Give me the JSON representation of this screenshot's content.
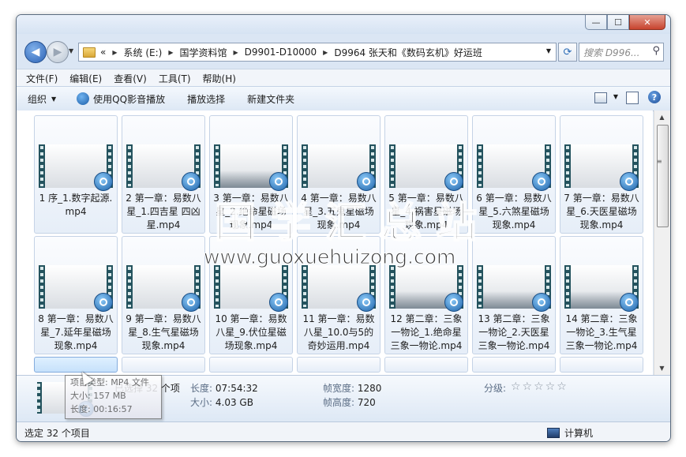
{
  "window": {
    "min": "—",
    "max": "☐",
    "close": "✕"
  },
  "nav": {
    "back": "◀",
    "forward": "▶"
  },
  "address": {
    "prefix": "«",
    "crumbs": [
      "系统 (E:)",
      "国学资料馆",
      "D9901-D10000",
      "D9964 张天和《数码玄机》好运班"
    ]
  },
  "search": {
    "placeholder": "搜索 D996..."
  },
  "menu": [
    "文件(F)",
    "编辑(E)",
    "查看(V)",
    "工具(T)",
    "帮助(H)"
  ],
  "toolbar": {
    "organize": "组织",
    "play_qq": "使用QQ影音播放",
    "play_select": "播放选择",
    "new_folder": "新建文件夹"
  },
  "files": [
    "1 序_1.数字起源.mp4",
    "2 第一章：易数八星_1.四吉星 四凶星.mp4",
    "3 第一章：易数八星_2.绝命星磁场现象.mp4",
    "4 第一章：易数八星_3.五鬼星磁场现象.mp4",
    "5 第一章：易数八星_4.祸害星磁场现象.mp4",
    "6 第一章：易数八星_5.六煞星磁场现象.mp4",
    "7 第一章：易数八星_6.天医星磁场现象.mp4",
    "8 第一章：易数八星_7.延年星磁场现象.mp4",
    "9 第一章：易数八星_8.生气星磁场现象.mp4",
    "10 第一章：易数八星_9.伏位星磁场现象.mp4",
    "11 第一章：易数八星_10.0与5的奇妙运用.mp4",
    "12 第二章：三象一物论_1.绝命星三象一物论.mp4",
    "13 第二章：三象一物论_2.天医星三象一物论.mp4",
    "14 第二章：三象一物论_3.生气星三象一物论.mp4"
  ],
  "watermark": {
    "cn": "国学汇总站",
    "url": "www.guoxuehuizong.com"
  },
  "details": {
    "selected": "已选择 32 个项",
    "length_label": "长度:",
    "length": "07:54:32",
    "size_label": "大小:",
    "size": "4.03 GB",
    "frame_width_label": "帧宽度:",
    "frame_width": "1280",
    "frame_height_label": "帧高度:",
    "frame_height": "720",
    "rating_label": "分级:",
    "rating_stars": "☆☆☆☆☆"
  },
  "tooltip": {
    "type": "项目类型: MP4 文件",
    "size": "大小: 157 MB",
    "length": "长度: 00:16:57"
  },
  "status": {
    "left": "选定 32 个项目",
    "right": "计算机"
  }
}
